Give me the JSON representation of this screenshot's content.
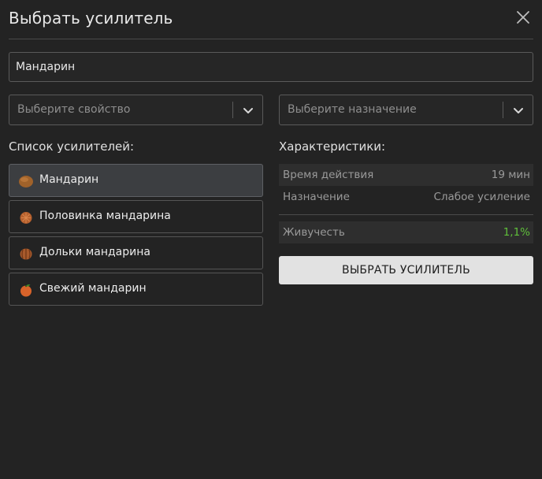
{
  "dialog": {
    "title": "Выбрать усилитель",
    "close_icon": "close-icon"
  },
  "search": {
    "value": "Мандарин"
  },
  "filters": {
    "property": {
      "placeholder": "Выберите свойство",
      "icon": "chevron-down-icon"
    },
    "purpose": {
      "placeholder": "Выберите назначение",
      "icon": "chevron-down-icon"
    }
  },
  "list": {
    "heading": "Список усилителей:",
    "items": [
      {
        "label": "Мандарин",
        "icon": "mandarin-icon",
        "selected": true
      },
      {
        "label": "Половинка мандарина",
        "icon": "half-mandarin-icon",
        "selected": false
      },
      {
        "label": "Дольки мандарина",
        "icon": "mandarin-slices-icon",
        "selected": false
      },
      {
        "label": "Свежий мандарин",
        "icon": "fresh-mandarin-icon",
        "selected": false
      }
    ]
  },
  "stats": {
    "heading": "Характеристики:",
    "rows": [
      {
        "key": "Время действия",
        "value": "19 мин"
      },
      {
        "key": "Назначение",
        "value": "Слабое усиление"
      },
      {
        "key": "Живучесть",
        "value": "1,1%"
      }
    ],
    "positive_color": "#5fbf3a"
  },
  "apply_button": {
    "label": "ВЫБРАТЬ УСИЛИТЕЛЬ"
  }
}
